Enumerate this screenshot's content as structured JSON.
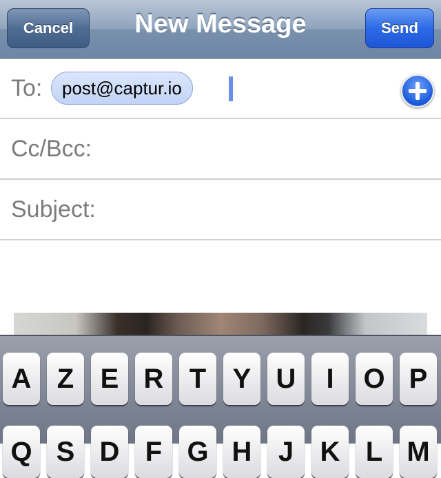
{
  "navbar": {
    "title": "New Message",
    "cancel_label": "Cancel",
    "send_label": "Send"
  },
  "fields": {
    "to_label": "To:",
    "to_recipient": "post@captur.io",
    "cc_label": "Cc/Bcc:",
    "subject_label": "Subject:"
  },
  "icons": {
    "add_contact": "plus-circle-icon"
  },
  "colors": {
    "send_button": "#2d6ae6",
    "navbar": "#7a91ad",
    "cursor": "#6b8ee8"
  },
  "keyboard": {
    "row1": [
      "A",
      "Z",
      "E",
      "R",
      "T",
      "Y",
      "U",
      "I",
      "O",
      "P"
    ],
    "row2": [
      "Q",
      "S",
      "D",
      "F",
      "G",
      "H",
      "J",
      "K",
      "L",
      "M"
    ]
  }
}
